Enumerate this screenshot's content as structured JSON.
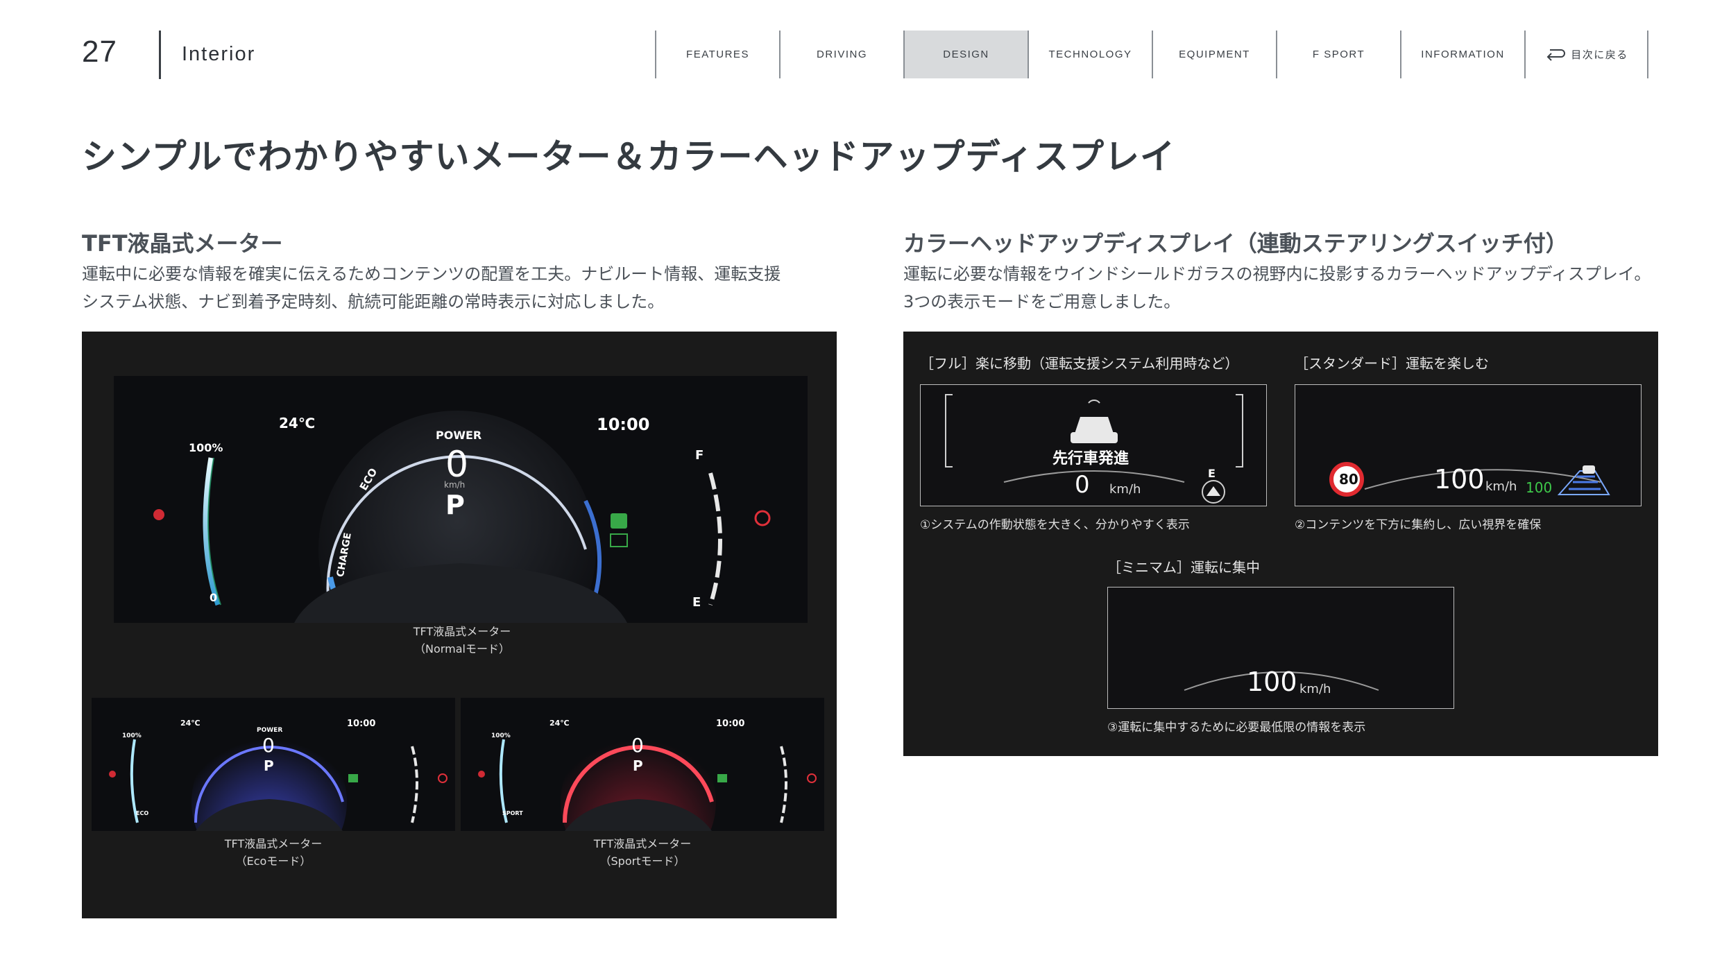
{
  "header": {
    "page_number": "27",
    "section": "Interior",
    "nav": [
      {
        "label": "FEATURES",
        "active": false
      },
      {
        "label": "DRIVING",
        "active": false
      },
      {
        "label": "DESIGN",
        "active": true
      },
      {
        "label": "TECHNOLOGY",
        "active": false
      },
      {
        "label": "EQUIPMENT",
        "active": false
      },
      {
        "label": "F SPORT",
        "active": false
      },
      {
        "label": "INFORMATION",
        "active": false
      }
    ],
    "back": {
      "label": "目次に戻る",
      "icon": "return-arrow-icon"
    }
  },
  "page_title": "シンプルでわかりやすいメーター＆カラーヘッドアップディスプレイ",
  "left": {
    "heading": "TFT液晶式メーター",
    "body_line1": "運転中に必要な情報を確実に伝えるためコンテンツの配置を工夫。ナビルート情報、運転支援",
    "body_line2": "システム状態、ナビ到着予定時刻、航続可能距離の常時表示に対応しました。",
    "meter_normal": {
      "temp": "24℃",
      "clock": "10:00",
      "power": "POWER",
      "eco": "ECO",
      "charge": "CHARGE",
      "speed": "0",
      "unit": "km/h",
      "gear": "P",
      "fuel_top": "100%",
      "fuel_bottom": "0",
      "f": "F",
      "e": "E",
      "caption1": "TFT液晶式メーター",
      "caption2": "（Normalモード）"
    },
    "meter_eco": {
      "temp": "24℃",
      "clock": "10:00",
      "power": "POWER",
      "speed": "0",
      "gear": "P",
      "fuel_top": "100%",
      "mode": "ECO",
      "caption1": "TFT液晶式メーター",
      "caption2": "（Ecoモード）",
      "accent": "#4a5cd8"
    },
    "meter_sport": {
      "temp": "24℃",
      "clock": "10:00",
      "speed": "0",
      "gear": "P",
      "fuel_top": "100%",
      "mode": "SPORT",
      "caption1": "TFT液晶式メーター",
      "caption2": "（Sportモード）",
      "accent": "#d4283a"
    }
  },
  "right": {
    "heading": "カラーヘッドアップディスプレイ（連動ステアリングスイッチ付）",
    "body_line1": "運転に必要な情報をウインドシールドガラスの視野内に投影するカラーヘッドアップディスプレイ。",
    "body_line2": "3つの表示モードをご用意しました。",
    "full": {
      "label": "［フル］楽に移動（運転支援システム利用時など）",
      "message": "先行車発進",
      "speed": "0",
      "unit": "km/h",
      "e": "E",
      "note": "①システムの作動状態を大きく、分かりやすく表示"
    },
    "standard": {
      "label": "［スタンダード］運転を楽しむ",
      "limit": "80",
      "speed": "100",
      "unit": "km/h",
      "set_speed": "100",
      "note": "②コンテンツを下方に集約し、広い視界を確保"
    },
    "minimum": {
      "label": "［ミニマム］運転に集中",
      "speed": "100",
      "unit": "km/h",
      "note": "③運転に集中するために必要最低限の情報を表示"
    }
  }
}
